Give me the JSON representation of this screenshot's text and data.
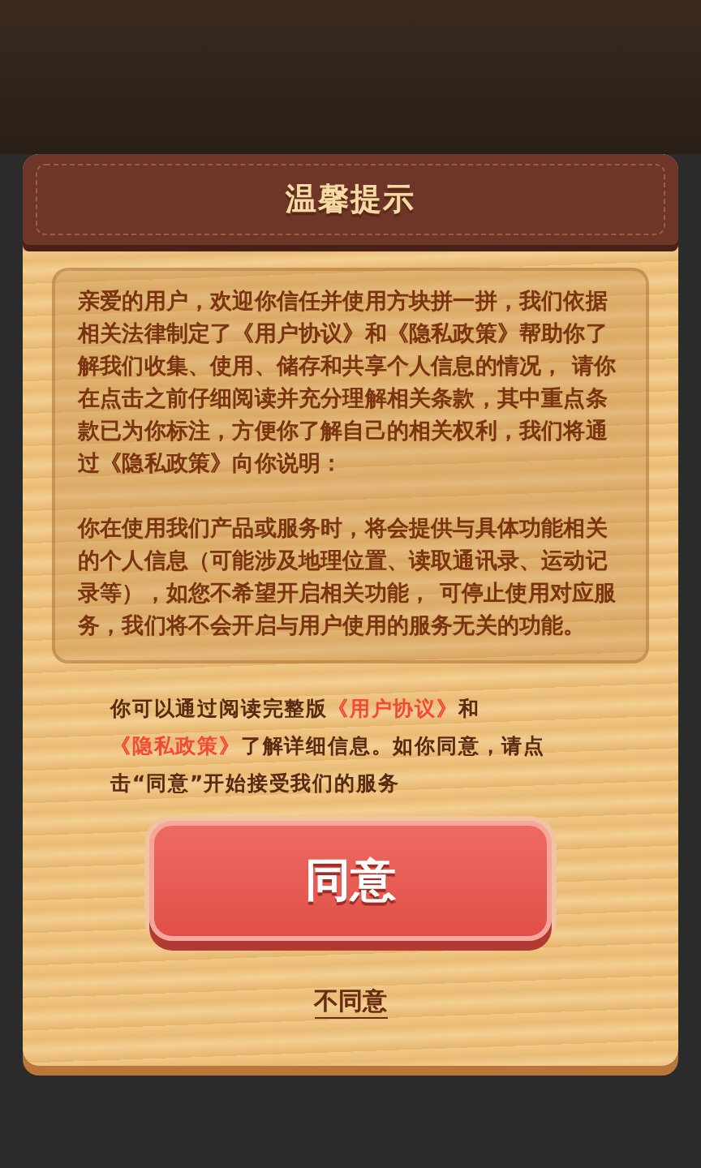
{
  "dialog": {
    "title": "温馨提示",
    "paragraphs": [
      "亲爱的用户，欢迎你信任并使用方块拼一拼，我们依据相关法律制定了《用户协议》和《隐私政策》帮助你了解我们收集、使用、储存和共享个人信息的情况， 请你在点击之前仔细阅读并充分理解相关条款，其中重点条款已为你标注，方便你了解自己的相关权利，我们将通过《隐私政策》向你说明：",
      "你在使用我们产品或服务时，将会提供与具体功能相关的个人信息（可能涉及地理位置、读取通讯录、运动记录等），如您不希望开启相关功能， 可停止使用对应服务，我们将不会开启与用户使用的服务无关的功能。"
    ],
    "notice": [
      {
        "kind": "text",
        "text": "你可以通过阅读完整版"
      },
      {
        "kind": "link",
        "text": "《用户协议》"
      },
      {
        "kind": "text",
        "text": "和"
      },
      {
        "kind": "link",
        "text": "《隐私政策》"
      },
      {
        "kind": "text",
        "text": "了解详细信息。如你同意，请点击“同意”开始接受我们的服务"
      }
    ],
    "agree_button": "同意",
    "disagree_link": "不同意"
  }
}
